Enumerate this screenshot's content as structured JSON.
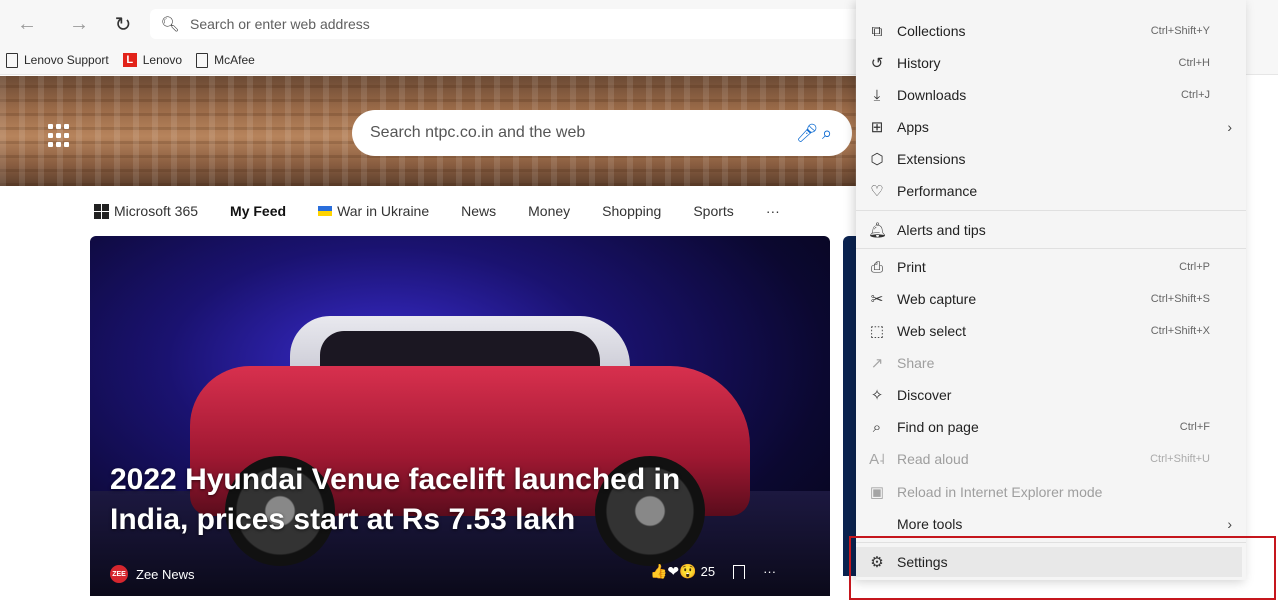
{
  "toolbar": {
    "back_icon": "arrow-left-icon",
    "forward_icon": "arrow-right-icon",
    "refresh_icon": "refresh-icon",
    "address_placeholder": "Search or enter web address"
  },
  "favorites": [
    {
      "label": "Lenovo Support",
      "icon": "page-icon"
    },
    {
      "label": "Lenovo",
      "icon": "lenovo-logo"
    },
    {
      "label": "McAfee",
      "icon": "page-icon"
    }
  ],
  "hero": {
    "search_placeholder": "Search ntpc.co.in and the web"
  },
  "nav": {
    "items": [
      "Microsoft 365",
      "My Feed",
      "War in Ukraine",
      "News",
      "Money",
      "Shopping",
      "Sports",
      "···"
    ],
    "active": "My Feed"
  },
  "feature": {
    "headline_line1": "2022 Hyundai Venue facelift launched in",
    "headline_line2": "India, prices start at Rs 7.53 lakh",
    "source": "Zee News",
    "source_logo_text": "ZEE",
    "reactions_count": "25",
    "more_label": "···"
  },
  "menu": {
    "items": [
      {
        "label": "Collections",
        "shortcut": "Ctrl+Shift+Y",
        "icon": "collections-icon"
      },
      {
        "label": "History",
        "shortcut": "Ctrl+H",
        "icon": "history-icon"
      },
      {
        "label": "Downloads",
        "shortcut": "Ctrl+J",
        "icon": "download-icon"
      },
      {
        "label": "Apps",
        "shortcut": "",
        "icon": "apps-icon",
        "submenu": true
      },
      {
        "label": "Extensions",
        "shortcut": "",
        "icon": "extensions-icon"
      },
      {
        "label": "Performance",
        "shortcut": "",
        "icon": "performance-icon"
      },
      {
        "label": "Alerts and tips",
        "shortcut": "",
        "icon": "bell-icon"
      },
      {
        "label": "Print",
        "shortcut": "Ctrl+P",
        "icon": "print-icon"
      },
      {
        "label": "Web capture",
        "shortcut": "Ctrl+Shift+S",
        "icon": "web-capture-icon"
      },
      {
        "label": "Web select",
        "shortcut": "Ctrl+Shift+X",
        "icon": "web-select-icon"
      },
      {
        "label": "Share",
        "shortcut": "",
        "icon": "share-icon",
        "disabled": true
      },
      {
        "label": "Discover",
        "shortcut": "",
        "icon": "discover-icon"
      },
      {
        "label": "Find on page",
        "shortcut": "Ctrl+F",
        "icon": "find-icon"
      },
      {
        "label": "Read aloud",
        "shortcut": "Ctrl+Shift+U",
        "icon": "read-aloud-icon",
        "disabled": true
      },
      {
        "label": "Reload in Internet Explorer mode",
        "shortcut": "",
        "icon": "ie-mode-icon",
        "disabled": true
      },
      {
        "label": "More tools",
        "shortcut": "",
        "icon": "",
        "submenu": true
      },
      {
        "label": "Settings",
        "shortcut": "",
        "icon": "gear-icon"
      }
    ]
  },
  "colors": {
    "highlight_border": "#c5161d",
    "accent": "#0e6bd1"
  }
}
